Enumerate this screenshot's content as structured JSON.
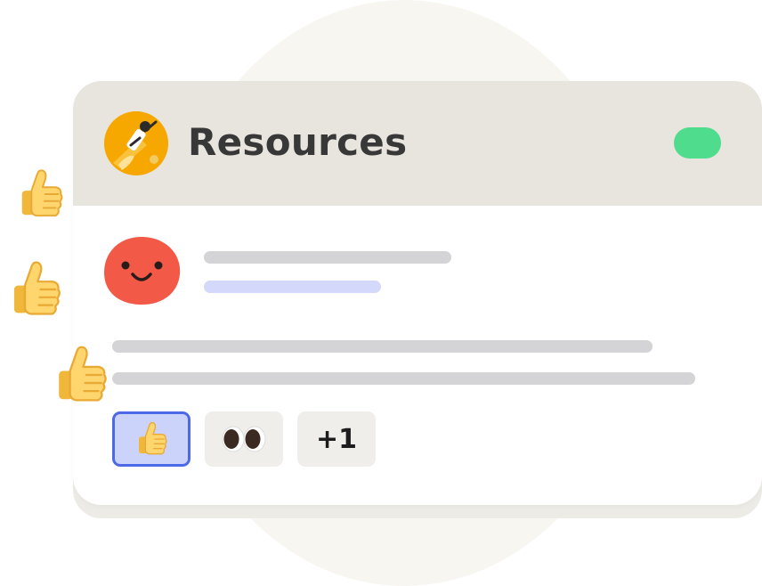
{
  "channel": {
    "title": "Resources",
    "avatar_icon": "rocket-illustration-icon",
    "status_color": "#4fdc8c"
  },
  "message": {
    "author_avatar_icon": "smiley-blob-icon",
    "author_avatar_color": "#f25a47"
  },
  "reactions": [
    {
      "icon": "thumbs-up-icon",
      "selected": true
    },
    {
      "icon": "eyes-icon",
      "selected": false
    },
    {
      "label": "+1",
      "selected": false
    }
  ],
  "decorations": {
    "floating_icons": [
      "thumbs-up-icon",
      "thumbs-up-icon",
      "thumbs-up-icon"
    ]
  },
  "colors": {
    "header_bg": "#e7e5de",
    "accent": "#4e69e8",
    "skeleton": "#d4d4d6",
    "skeleton_accent": "#d4d8fa"
  }
}
